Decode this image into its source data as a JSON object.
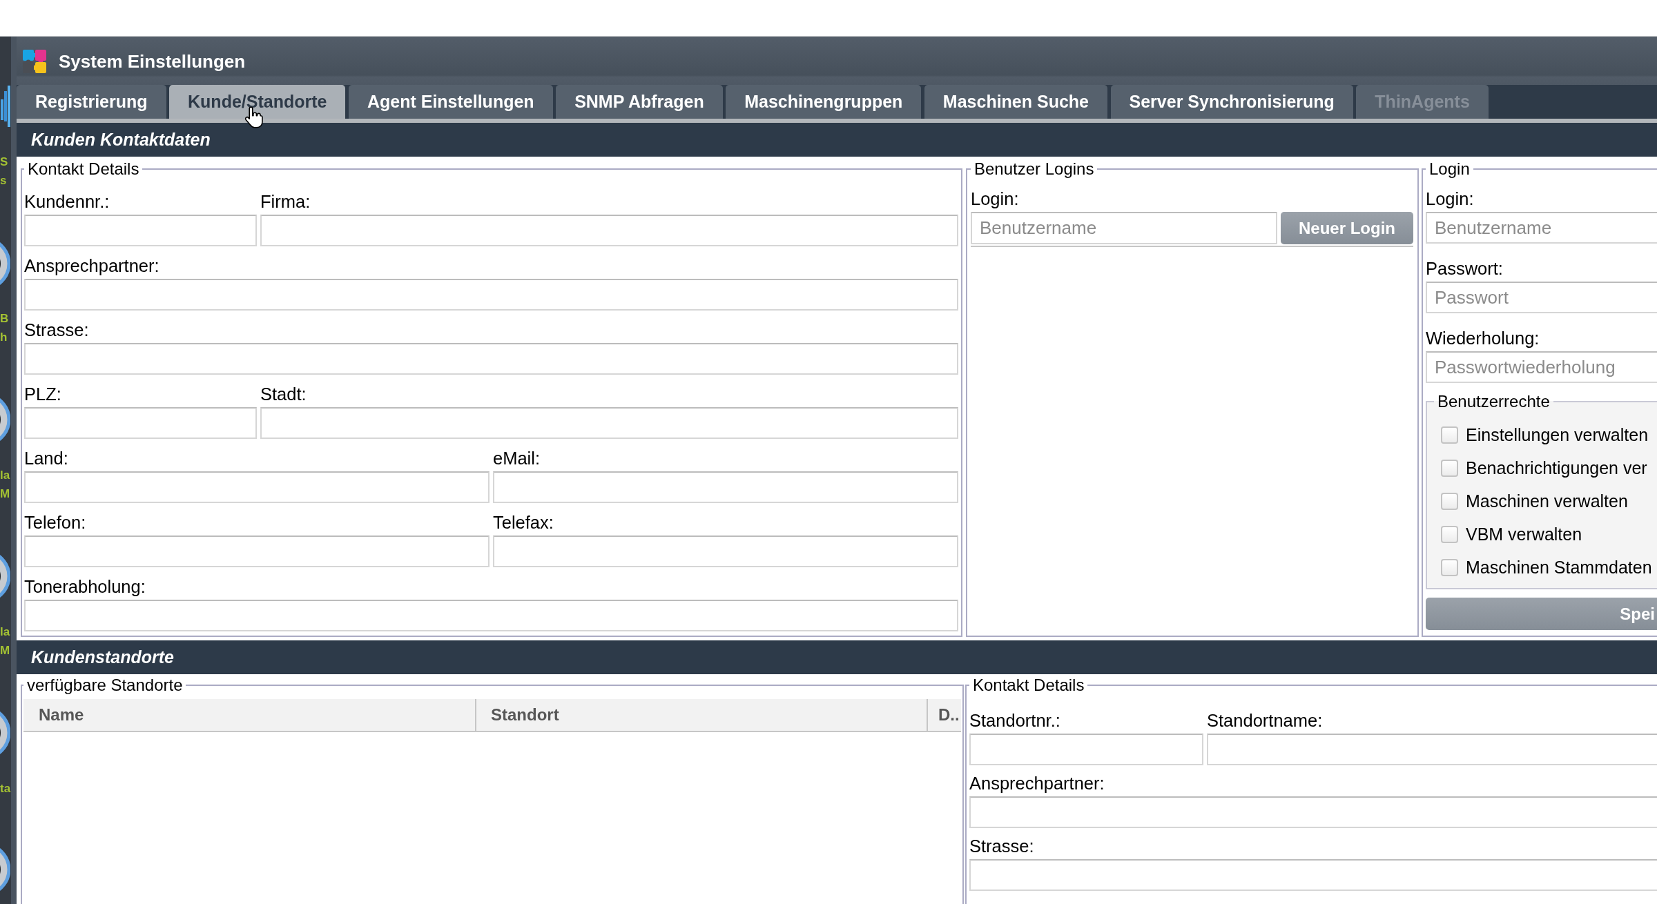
{
  "desktop": {
    "labels": [
      [
        "S",
        "s"
      ],
      [
        "B",
        "h"
      ],
      [
        "la",
        "M"
      ],
      [
        "la",
        "M"
      ],
      [
        "ta"
      ]
    ]
  },
  "window": {
    "title": "System Einstellungen"
  },
  "tabs": [
    {
      "label": "Registrierung",
      "selected": false,
      "disabled": false
    },
    {
      "label": "Kunde/Standorte",
      "selected": true,
      "disabled": false
    },
    {
      "label": "Agent Einstellungen",
      "selected": false,
      "disabled": false
    },
    {
      "label": "SNMP Abfragen",
      "selected": false,
      "disabled": false
    },
    {
      "label": "Maschinengruppen",
      "selected": false,
      "disabled": false
    },
    {
      "label": "Maschinen Suche",
      "selected": false,
      "disabled": false
    },
    {
      "label": "Server Synchronisierung",
      "selected": false,
      "disabled": false
    },
    {
      "label": "ThinAgents",
      "selected": false,
      "disabled": true
    }
  ],
  "customer_section": {
    "title": "Kunden Kontaktdaten",
    "contact_details": {
      "legend": "Kontakt Details",
      "rows": [
        [
          {
            "label": "Kundennr.:"
          },
          {
            "label": "Firma:"
          }
        ],
        [
          {
            "label": "Ansprechpartner:"
          }
        ],
        [
          {
            "label": "Strasse:"
          }
        ],
        [
          {
            "label": "PLZ:"
          },
          {
            "label": "Stadt:"
          }
        ],
        [
          {
            "label": "Land:"
          },
          {
            "label": "eMail:"
          }
        ],
        [
          {
            "label": "Telefon:"
          },
          {
            "label": "Telefax:"
          }
        ],
        [
          {
            "label": "Tonerabholung:"
          }
        ]
      ]
    },
    "user_logins": {
      "legend": "Benutzer Logins",
      "label": "Login:",
      "placeholder": "Benutzername",
      "button": "Neuer Login"
    },
    "login": {
      "legend": "Login",
      "fields": [
        {
          "label": "Login:",
          "placeholder": "Benutzername"
        },
        {
          "label": "Passwort:",
          "placeholder": "Passwort"
        },
        {
          "label": "Wiederholung:",
          "placeholder": "Passwortwiederholung"
        }
      ],
      "rights": {
        "legend": "Benutzerrechte",
        "items": [
          {
            "label": "Einstellungen verwalten",
            "checked": false
          },
          {
            "label": "Benachrichtigungen ver",
            "checked": false
          },
          {
            "label": "Maschinen verwalten",
            "checked": false
          },
          {
            "label": "VBM verwalten",
            "checked": false
          },
          {
            "label": "Maschinen Stammdaten",
            "checked": false
          }
        ]
      },
      "save_button": "Spei"
    }
  },
  "locations_section": {
    "title": "Kundenstandorte",
    "available": {
      "legend": "verfügbare Standorte",
      "table": {
        "columns": [
          "Name",
          "Standort",
          "D.."
        ]
      }
    },
    "contact_details": {
      "legend": "Kontakt Details",
      "rows": [
        [
          {
            "label": "Standortnr.:"
          },
          {
            "label": "Standortname:"
          }
        ],
        [
          {
            "label": "Ansprechpartner:"
          }
        ],
        [
          {
            "label": "Strasse:"
          }
        ]
      ]
    }
  }
}
